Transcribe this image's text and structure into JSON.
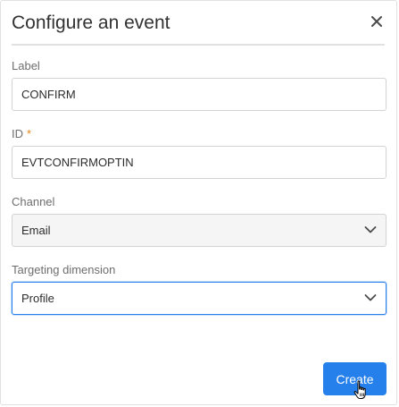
{
  "dialog": {
    "title": "Configure an event",
    "close_icon": "close-icon"
  },
  "fields": {
    "label": {
      "label": "Label",
      "value": "CONFIRM"
    },
    "id": {
      "label": "ID",
      "required_mark": "*",
      "value": "EVTCONFIRMOPTIN"
    },
    "channel": {
      "label": "Channel",
      "selected": "Email"
    },
    "targeting_dimension": {
      "label": "Targeting dimension",
      "selected": "Profile"
    }
  },
  "actions": {
    "create_label": "Create"
  },
  "colors": {
    "accent": "#2680eb",
    "required": "#e68619",
    "border": "#d3d3d3",
    "select_bg": "#f5f5f5"
  },
  "icons": {
    "select_arrow": "chevron-down-icon",
    "pointer": "hand-cursor-icon"
  }
}
